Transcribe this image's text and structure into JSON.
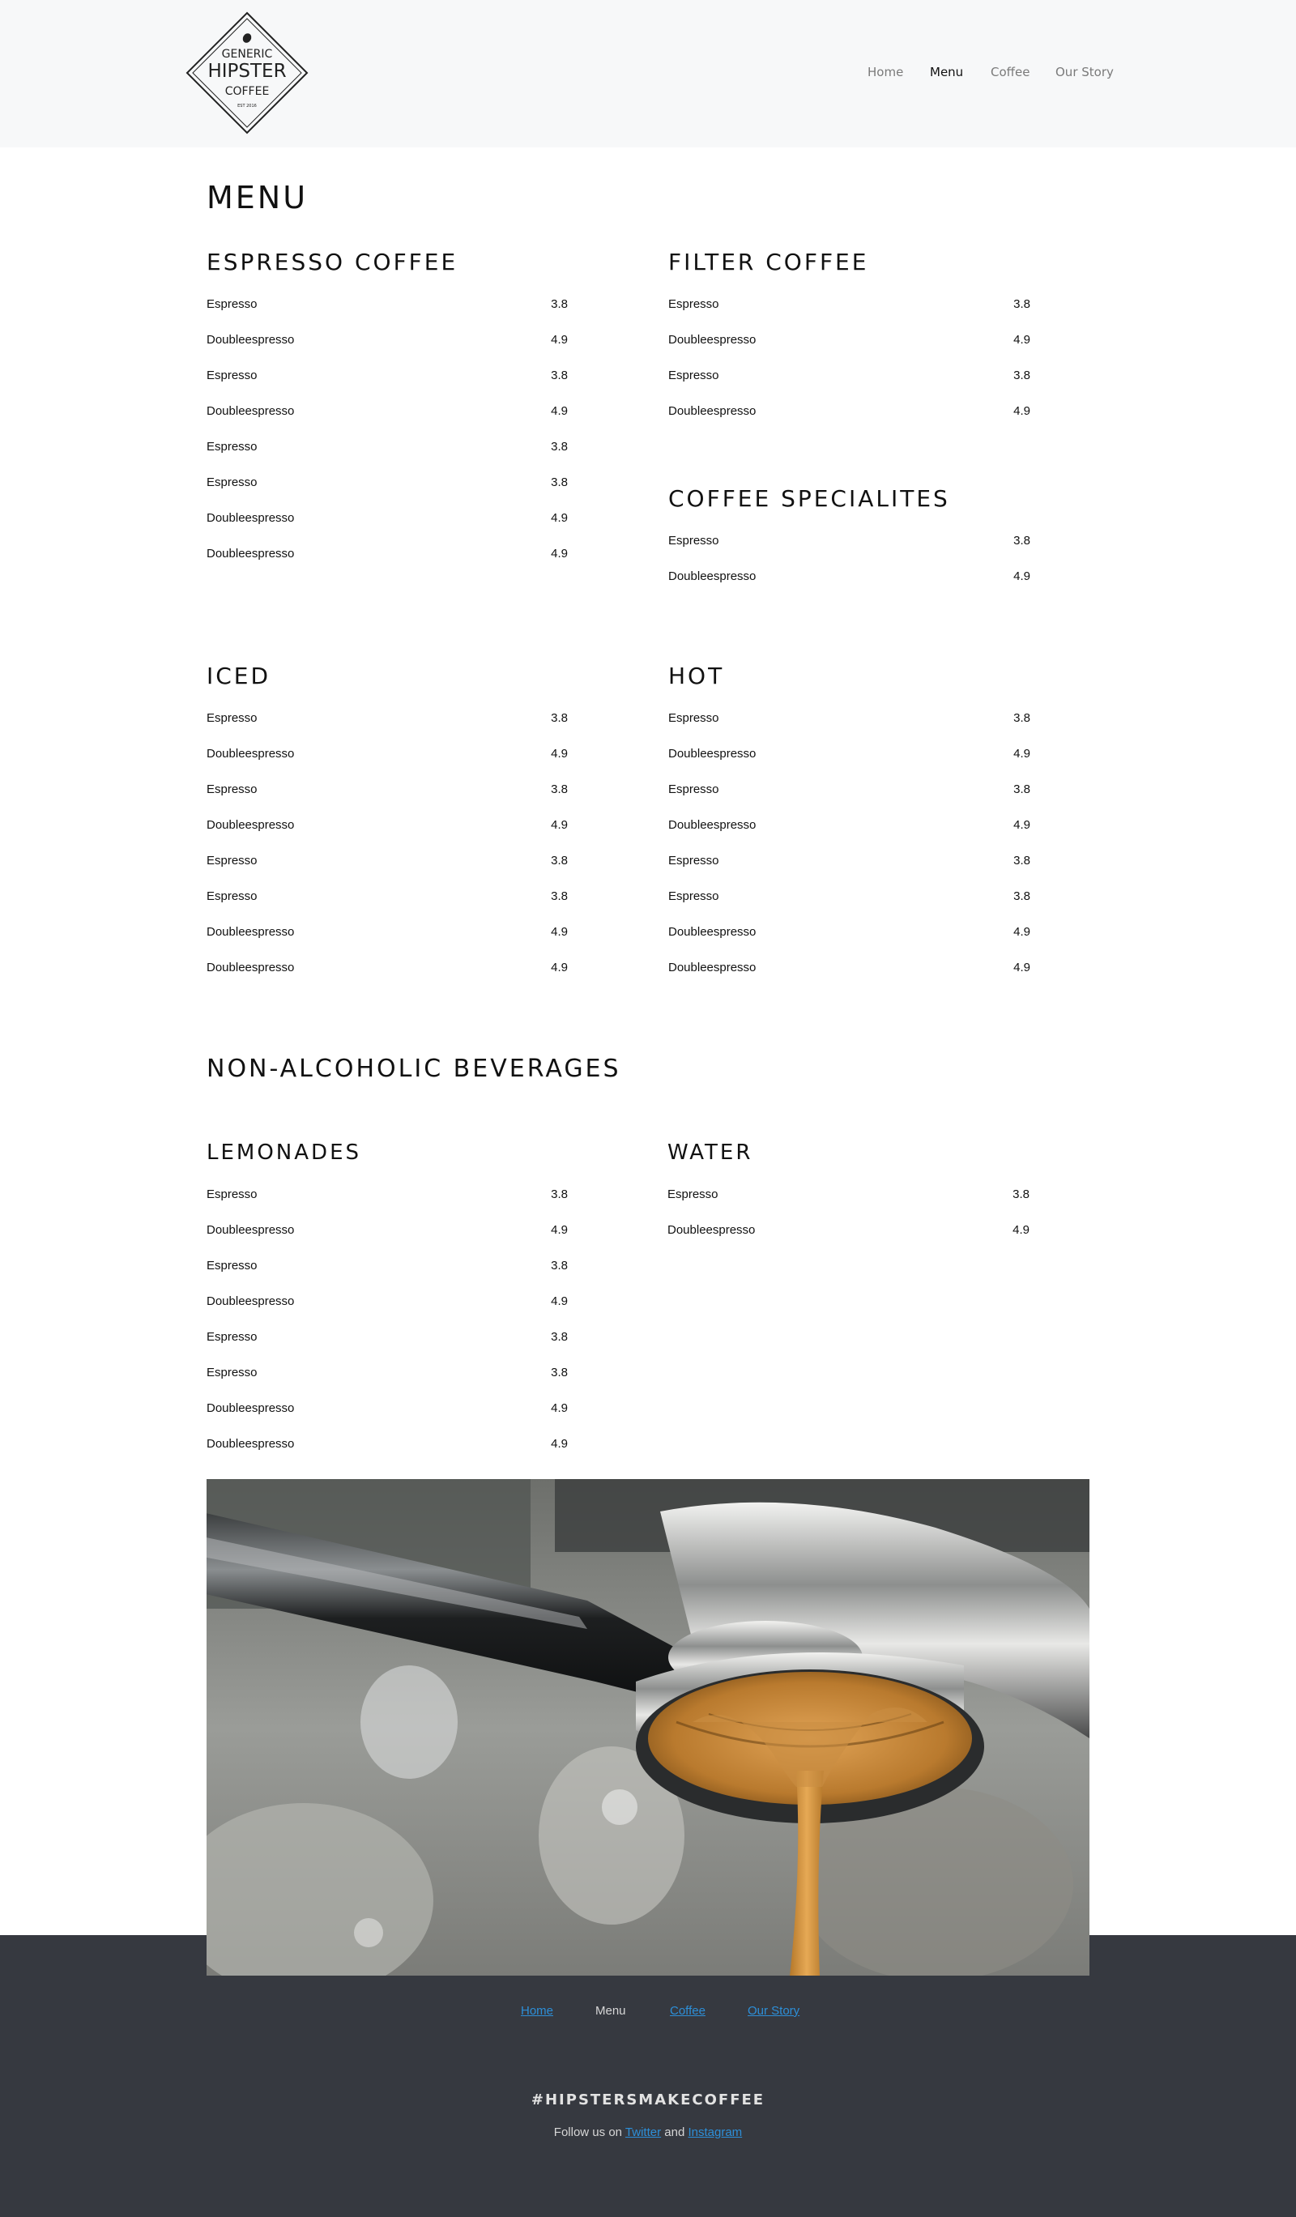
{
  "brand": {
    "line1": "GENERIC",
    "line2": "HIPSTER",
    "line3": "COFFEE",
    "est": "EST 2016"
  },
  "nav": {
    "items": [
      {
        "label": "Home",
        "active": false
      },
      {
        "label": "Menu",
        "active": true
      },
      {
        "label": "Coffee",
        "active": false
      },
      {
        "label": "Our Story",
        "active": false
      }
    ]
  },
  "page_title": "MENU",
  "sections": {
    "espresso": {
      "title": "ESPRESSO COFFEE",
      "items": [
        {
          "name": "Espresso",
          "price": "3.8"
        },
        {
          "name": "Doubleespresso",
          "price": "4.9"
        },
        {
          "name": "Espresso",
          "price": "3.8"
        },
        {
          "name": "Doubleespresso",
          "price": "4.9"
        },
        {
          "name": "Espresso",
          "price": "3.8"
        },
        {
          "name": "Espresso",
          "price": "3.8"
        },
        {
          "name": "Doubleespresso",
          "price": "4.9"
        },
        {
          "name": "Doubleespresso",
          "price": "4.9"
        }
      ]
    },
    "filter": {
      "title": "FILTER COFFEE",
      "items": [
        {
          "name": "Espresso",
          "price": "3.8"
        },
        {
          "name": "Doubleespresso",
          "price": "4.9"
        },
        {
          "name": "Espresso",
          "price": "3.8"
        },
        {
          "name": "Doubleespresso",
          "price": "4.9"
        }
      ]
    },
    "specialties": {
      "title": "COFFEE SPECIALITES",
      "items": [
        {
          "name": "Espresso",
          "price": "3.8"
        },
        {
          "name": "Doubleespresso",
          "price": "4.9"
        }
      ]
    },
    "iced": {
      "title": "ICED",
      "items": [
        {
          "name": "Espresso",
          "price": "3.8"
        },
        {
          "name": "Doubleespresso",
          "price": "4.9"
        },
        {
          "name": "Espresso",
          "price": "3.8"
        },
        {
          "name": "Doubleespresso",
          "price": "4.9"
        },
        {
          "name": "Espresso",
          "price": "3.8"
        },
        {
          "name": "Espresso",
          "price": "3.8"
        },
        {
          "name": "Doubleespresso",
          "price": "4.9"
        },
        {
          "name": "Doubleespresso",
          "price": "4.9"
        }
      ]
    },
    "hot": {
      "title": "HOT",
      "items": [
        {
          "name": "Espresso",
          "price": "3.8"
        },
        {
          "name": "Doubleespresso",
          "price": "4.9"
        },
        {
          "name": "Espresso",
          "price": "3.8"
        },
        {
          "name": "Doubleespresso",
          "price": "4.9"
        },
        {
          "name": "Espresso",
          "price": "3.8"
        },
        {
          "name": "Espresso",
          "price": "3.8"
        },
        {
          "name": "Doubleespresso",
          "price": "4.9"
        },
        {
          "name": "Doubleespresso",
          "price": "4.9"
        }
      ]
    },
    "non_alcoholic_title": "NON-ALCOHOLIC BEVERAGES",
    "lemonades": {
      "title": "LEMONADES",
      "items": [
        {
          "name": "Espresso",
          "price": "3.8"
        },
        {
          "name": "Doubleespresso",
          "price": "4.9"
        },
        {
          "name": "Espresso",
          "price": "3.8"
        },
        {
          "name": "Doubleespresso",
          "price": "4.9"
        },
        {
          "name": "Espresso",
          "price": "3.8"
        },
        {
          "name": "Espresso",
          "price": "3.8"
        },
        {
          "name": "Doubleespresso",
          "price": "4.9"
        },
        {
          "name": "Doubleespresso",
          "price": "4.9"
        }
      ]
    },
    "water": {
      "title": "WATER",
      "items": [
        {
          "name": "Espresso",
          "price": "3.8"
        },
        {
          "name": "Doubleespresso",
          "price": "4.9"
        }
      ]
    }
  },
  "footer": {
    "nav": [
      {
        "label": "Home",
        "link": true
      },
      {
        "label": "Menu",
        "link": false
      },
      {
        "label": "Coffee",
        "link": true
      },
      {
        "label": "Our Story",
        "link": true
      }
    ],
    "hashtag": "#HIPSTERSMAKECOFFEE",
    "follow_prefix": "Follow us on",
    "twitter": "Twitter",
    "and": "and",
    "instagram": "Instagram"
  },
  "colors": {
    "header_bg": "#f7f8f9",
    "footer_bg": "#363940",
    "link": "#2d8fd8"
  }
}
